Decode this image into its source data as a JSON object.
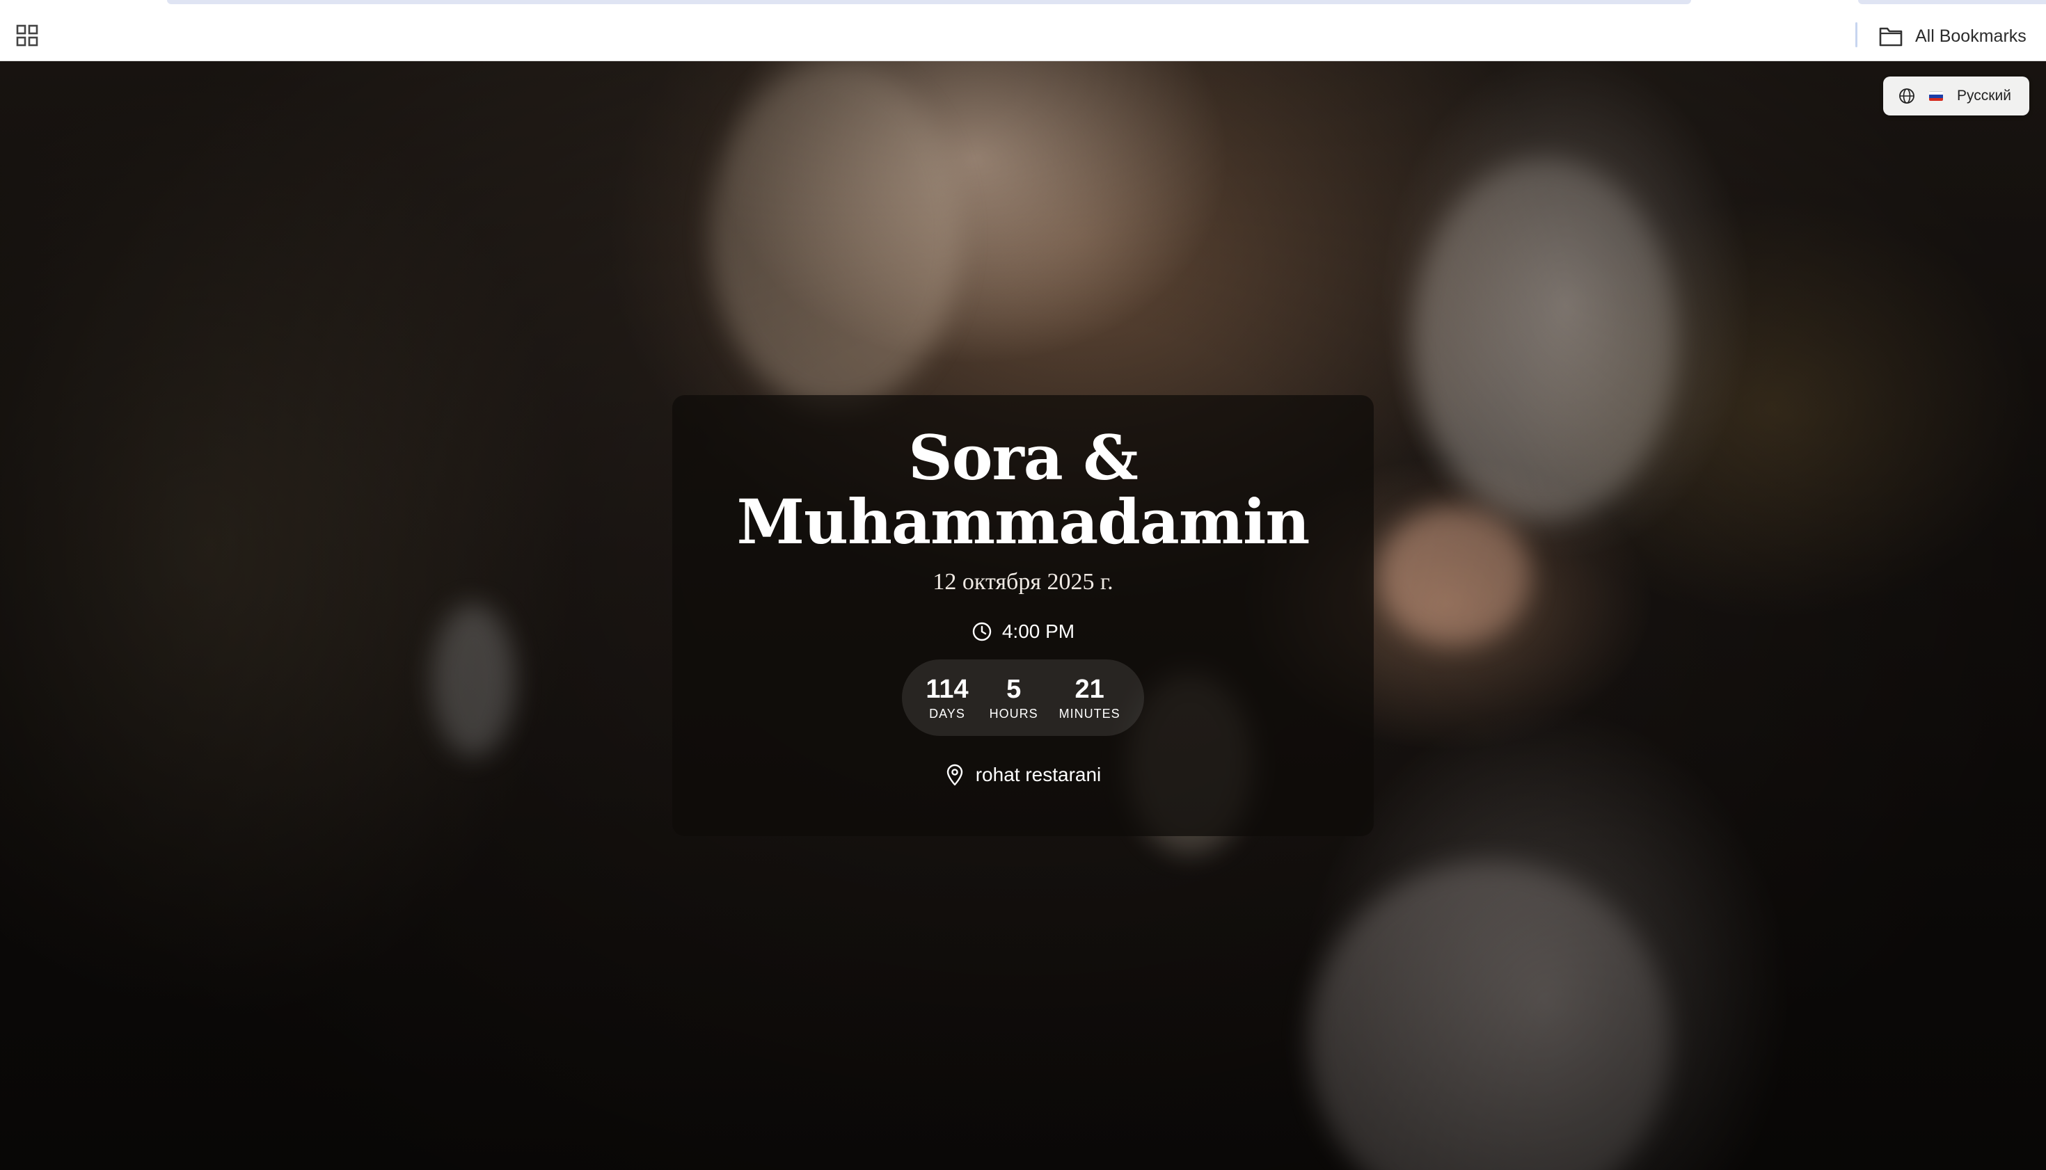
{
  "browser": {
    "bookmarks_bar": {
      "apps_icon": "apps-grid-icon",
      "all_bookmarks_label": "All Bookmarks",
      "all_bookmarks_icon": "folder-icon"
    }
  },
  "page": {
    "language_switcher": {
      "label": "Русский",
      "icon": "globe-icon",
      "flag": "russian-flag",
      "flag_colors": [
        "#ffffff",
        "#1c3fa8",
        "#d52b1e"
      ]
    },
    "invitation": {
      "names_line1": "Sora &",
      "names_line2": "Muhammadamin",
      "date": "12 октября 2025 г.",
      "time": "4:00 PM",
      "time_icon": "clock-icon",
      "countdown": [
        {
          "value": "114",
          "label": "DAYS"
        },
        {
          "value": "5",
          "label": "HOURS"
        },
        {
          "value": "21",
          "label": "MINUTES"
        }
      ],
      "venue": "rohat restarani",
      "venue_icon": "map-pin-icon"
    }
  }
}
